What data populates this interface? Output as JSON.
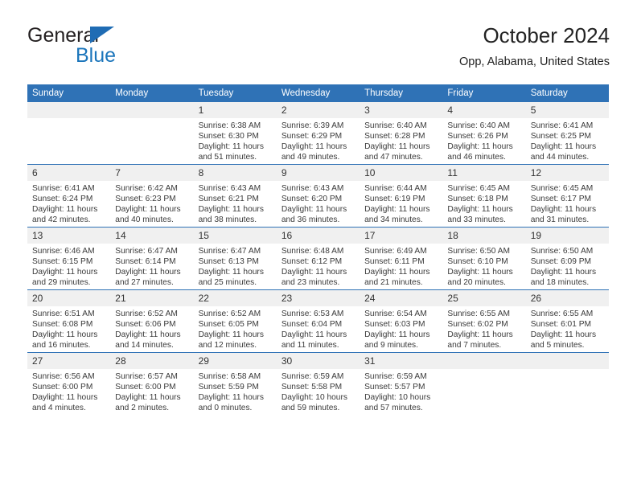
{
  "logo": {
    "word_primary": "General",
    "word_secondary": "Blue",
    "triangle_color": "#1f6cb4",
    "secondary_color": "#1b75bb"
  },
  "header": {
    "title": "October 2024",
    "subtitle": "Opp, Alabama, United States"
  },
  "theme": {
    "header_bg": "#2f72b6",
    "daynum_bg": "#f0f0f0",
    "row_divider": "#2f72b6"
  },
  "calendar": {
    "weekday_headers": [
      "Sunday",
      "Monday",
      "Tuesday",
      "Wednesday",
      "Thursday",
      "Friday",
      "Saturday"
    ],
    "labels": {
      "sunrise": "Sunrise:",
      "sunset": "Sunset:",
      "daylight": "Daylight:"
    },
    "weeks": [
      [
        {
          "day": "",
          "empty": true
        },
        {
          "day": "",
          "empty": true
        },
        {
          "day": "1",
          "sunrise": "Sunrise: 6:38 AM",
          "sunset": "Sunset: 6:30 PM",
          "daylight_line1": "Daylight: 11 hours",
          "daylight_line2": "and 51 minutes."
        },
        {
          "day": "2",
          "sunrise": "Sunrise: 6:39 AM",
          "sunset": "Sunset: 6:29 PM",
          "daylight_line1": "Daylight: 11 hours",
          "daylight_line2": "and 49 minutes."
        },
        {
          "day": "3",
          "sunrise": "Sunrise: 6:40 AM",
          "sunset": "Sunset: 6:28 PM",
          "daylight_line1": "Daylight: 11 hours",
          "daylight_line2": "and 47 minutes."
        },
        {
          "day": "4",
          "sunrise": "Sunrise: 6:40 AM",
          "sunset": "Sunset: 6:26 PM",
          "daylight_line1": "Daylight: 11 hours",
          "daylight_line2": "and 46 minutes."
        },
        {
          "day": "5",
          "sunrise": "Sunrise: 6:41 AM",
          "sunset": "Sunset: 6:25 PM",
          "daylight_line1": "Daylight: 11 hours",
          "daylight_line2": "and 44 minutes."
        }
      ],
      [
        {
          "day": "6",
          "sunrise": "Sunrise: 6:41 AM",
          "sunset": "Sunset: 6:24 PM",
          "daylight_line1": "Daylight: 11 hours",
          "daylight_line2": "and 42 minutes."
        },
        {
          "day": "7",
          "sunrise": "Sunrise: 6:42 AM",
          "sunset": "Sunset: 6:23 PM",
          "daylight_line1": "Daylight: 11 hours",
          "daylight_line2": "and 40 minutes."
        },
        {
          "day": "8",
          "sunrise": "Sunrise: 6:43 AM",
          "sunset": "Sunset: 6:21 PM",
          "daylight_line1": "Daylight: 11 hours",
          "daylight_line2": "and 38 minutes."
        },
        {
          "day": "9",
          "sunrise": "Sunrise: 6:43 AM",
          "sunset": "Sunset: 6:20 PM",
          "daylight_line1": "Daylight: 11 hours",
          "daylight_line2": "and 36 minutes."
        },
        {
          "day": "10",
          "sunrise": "Sunrise: 6:44 AM",
          "sunset": "Sunset: 6:19 PM",
          "daylight_line1": "Daylight: 11 hours",
          "daylight_line2": "and 34 minutes."
        },
        {
          "day": "11",
          "sunrise": "Sunrise: 6:45 AM",
          "sunset": "Sunset: 6:18 PM",
          "daylight_line1": "Daylight: 11 hours",
          "daylight_line2": "and 33 minutes."
        },
        {
          "day": "12",
          "sunrise": "Sunrise: 6:45 AM",
          "sunset": "Sunset: 6:17 PM",
          "daylight_line1": "Daylight: 11 hours",
          "daylight_line2": "and 31 minutes."
        }
      ],
      [
        {
          "day": "13",
          "sunrise": "Sunrise: 6:46 AM",
          "sunset": "Sunset: 6:15 PM",
          "daylight_line1": "Daylight: 11 hours",
          "daylight_line2": "and 29 minutes."
        },
        {
          "day": "14",
          "sunrise": "Sunrise: 6:47 AM",
          "sunset": "Sunset: 6:14 PM",
          "daylight_line1": "Daylight: 11 hours",
          "daylight_line2": "and 27 minutes."
        },
        {
          "day": "15",
          "sunrise": "Sunrise: 6:47 AM",
          "sunset": "Sunset: 6:13 PM",
          "daylight_line1": "Daylight: 11 hours",
          "daylight_line2": "and 25 minutes."
        },
        {
          "day": "16",
          "sunrise": "Sunrise: 6:48 AM",
          "sunset": "Sunset: 6:12 PM",
          "daylight_line1": "Daylight: 11 hours",
          "daylight_line2": "and 23 minutes."
        },
        {
          "day": "17",
          "sunrise": "Sunrise: 6:49 AM",
          "sunset": "Sunset: 6:11 PM",
          "daylight_line1": "Daylight: 11 hours",
          "daylight_line2": "and 21 minutes."
        },
        {
          "day": "18",
          "sunrise": "Sunrise: 6:50 AM",
          "sunset": "Sunset: 6:10 PM",
          "daylight_line1": "Daylight: 11 hours",
          "daylight_line2": "and 20 minutes."
        },
        {
          "day": "19",
          "sunrise": "Sunrise: 6:50 AM",
          "sunset": "Sunset: 6:09 PM",
          "daylight_line1": "Daylight: 11 hours",
          "daylight_line2": "and 18 minutes."
        }
      ],
      [
        {
          "day": "20",
          "sunrise": "Sunrise: 6:51 AM",
          "sunset": "Sunset: 6:08 PM",
          "daylight_line1": "Daylight: 11 hours",
          "daylight_line2": "and 16 minutes."
        },
        {
          "day": "21",
          "sunrise": "Sunrise: 6:52 AM",
          "sunset": "Sunset: 6:06 PM",
          "daylight_line1": "Daylight: 11 hours",
          "daylight_line2": "and 14 minutes."
        },
        {
          "day": "22",
          "sunrise": "Sunrise: 6:52 AM",
          "sunset": "Sunset: 6:05 PM",
          "daylight_line1": "Daylight: 11 hours",
          "daylight_line2": "and 12 minutes."
        },
        {
          "day": "23",
          "sunrise": "Sunrise: 6:53 AM",
          "sunset": "Sunset: 6:04 PM",
          "daylight_line1": "Daylight: 11 hours",
          "daylight_line2": "and 11 minutes."
        },
        {
          "day": "24",
          "sunrise": "Sunrise: 6:54 AM",
          "sunset": "Sunset: 6:03 PM",
          "daylight_line1": "Daylight: 11 hours",
          "daylight_line2": "and 9 minutes."
        },
        {
          "day": "25",
          "sunrise": "Sunrise: 6:55 AM",
          "sunset": "Sunset: 6:02 PM",
          "daylight_line1": "Daylight: 11 hours",
          "daylight_line2": "and 7 minutes."
        },
        {
          "day": "26",
          "sunrise": "Sunrise: 6:55 AM",
          "sunset": "Sunset: 6:01 PM",
          "daylight_line1": "Daylight: 11 hours",
          "daylight_line2": "and 5 minutes."
        }
      ],
      [
        {
          "day": "27",
          "sunrise": "Sunrise: 6:56 AM",
          "sunset": "Sunset: 6:00 PM",
          "daylight_line1": "Daylight: 11 hours",
          "daylight_line2": "and 4 minutes."
        },
        {
          "day": "28",
          "sunrise": "Sunrise: 6:57 AM",
          "sunset": "Sunset: 6:00 PM",
          "daylight_line1": "Daylight: 11 hours",
          "daylight_line2": "and 2 minutes."
        },
        {
          "day": "29",
          "sunrise": "Sunrise: 6:58 AM",
          "sunset": "Sunset: 5:59 PM",
          "daylight_line1": "Daylight: 11 hours",
          "daylight_line2": "and 0 minutes."
        },
        {
          "day": "30",
          "sunrise": "Sunrise: 6:59 AM",
          "sunset": "Sunset: 5:58 PM",
          "daylight_line1": "Daylight: 10 hours",
          "daylight_line2": "and 59 minutes."
        },
        {
          "day": "31",
          "sunrise": "Sunrise: 6:59 AM",
          "sunset": "Sunset: 5:57 PM",
          "daylight_line1": "Daylight: 10 hours",
          "daylight_line2": "and 57 minutes."
        },
        {
          "day": "",
          "empty": true
        },
        {
          "day": "",
          "empty": true
        }
      ]
    ]
  }
}
